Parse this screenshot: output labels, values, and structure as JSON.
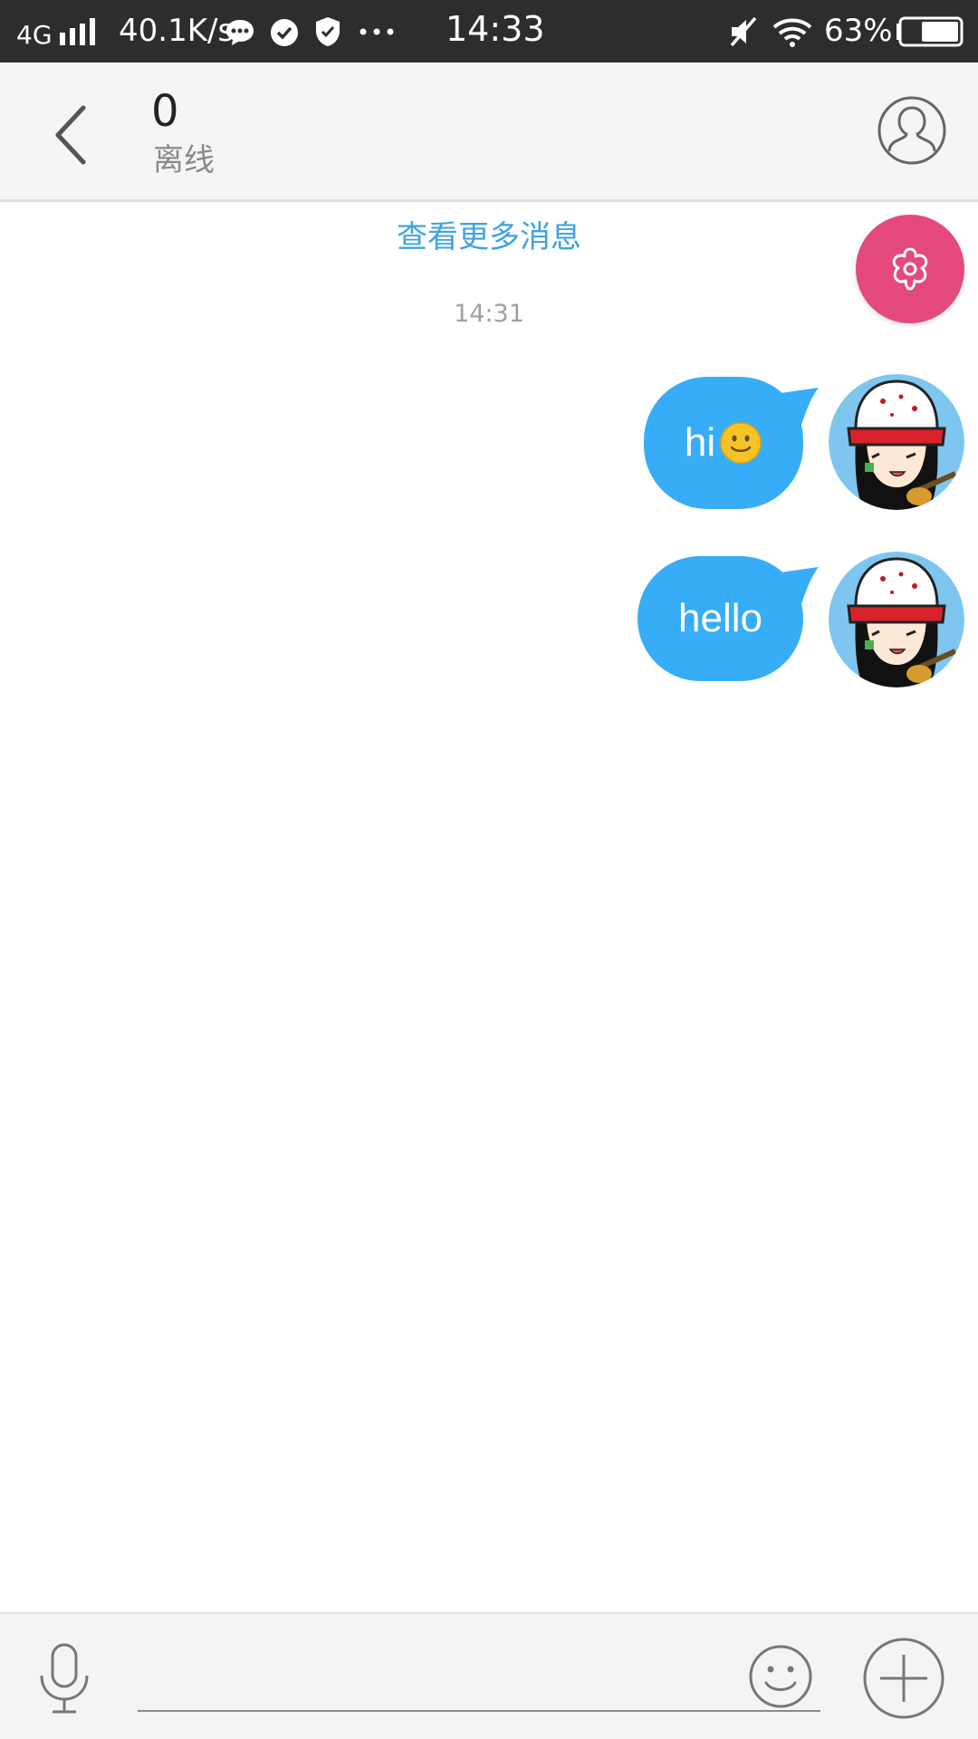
{
  "status_bar": {
    "network": "4G",
    "speed": "40.1K/s",
    "time": "14:33",
    "battery": "63%"
  },
  "header": {
    "title": "0",
    "status": "离线"
  },
  "chat": {
    "load_more": "查看更多消息",
    "timestamp": "14:31",
    "messages": [
      {
        "text": "hi",
        "emoji": "slightly-smiling-face",
        "sender": "self"
      },
      {
        "text": "hello",
        "sender": "self"
      }
    ]
  },
  "colors": {
    "bubble": "#37adf8",
    "link": "#3fa3e0",
    "fab": "#e4497e",
    "status_bar": "#2d2d2d"
  },
  "icons": {
    "back": "chevron-left-icon",
    "profile": "person-outline-icon",
    "fab": "flower-icon",
    "mic": "microphone-icon",
    "emoji": "smiley-icon",
    "plus": "plus-circle-icon"
  },
  "input": {
    "value": "",
    "placeholder": ""
  }
}
